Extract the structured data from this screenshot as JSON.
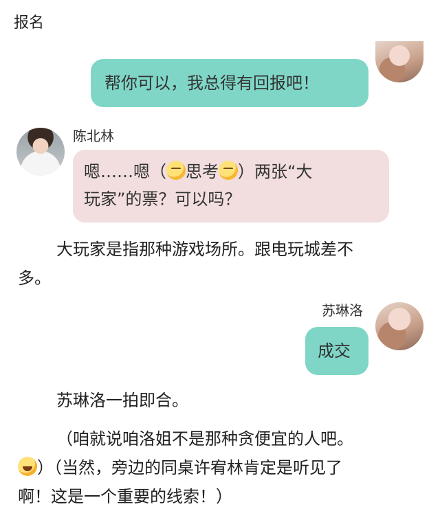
{
  "header": {
    "label": "报名"
  },
  "messages": [
    {
      "side": "right",
      "text": "帮你可以，我总得有回报吧！"
    },
    {
      "side": "left",
      "sender": "陈北林",
      "text_before": "嗯……嗯（",
      "emoji1": "thinking-face",
      "text_middle": "思考",
      "emoji2": "thinking-face",
      "text_after_line1": "）两张“大",
      "text_line2": "玩家”的票？可以吗？"
    },
    {
      "side": "right",
      "sender": "苏琳洛",
      "text": "成交"
    }
  ],
  "narration": {
    "p1_line1": "大玩家是指那种游戏场所。跟电玩城差不",
    "p1_line2": "多。",
    "p2": "苏琳洛一拍即合。",
    "p3_line1": "（咱就说咱洛姐不是那种贪便宜的人吧。",
    "p3_line2_after_emoji": "）（当然，旁边的同桌许宥林肯定是听见了",
    "p3_line3": "啊！这是一个重要的线索！）"
  },
  "icons": {
    "thinking": "thinking-face-emoji",
    "laugh": "tears-of-joy-emoji"
  },
  "colors": {
    "right_bubble": "#7fd6c6",
    "left_bubble": "#f2dede"
  }
}
